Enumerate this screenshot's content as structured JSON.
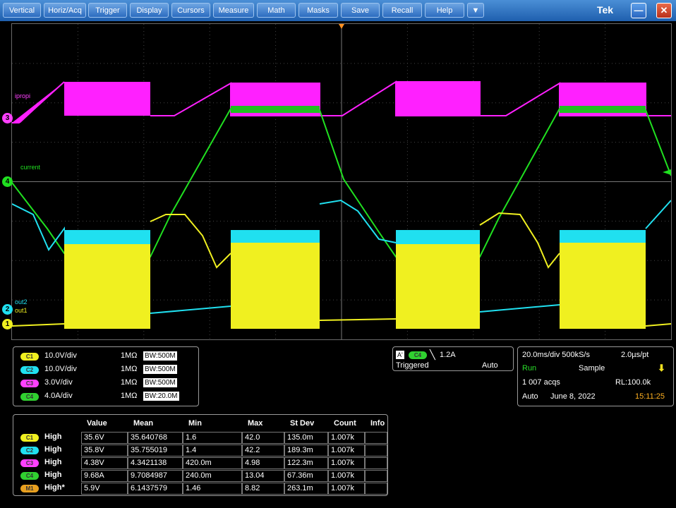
{
  "menubar": {
    "items": [
      "Vertical",
      "Horiz/Acq",
      "Trigger",
      "Display",
      "Cursors",
      "Measure",
      "Math",
      "Masks",
      "Save",
      "Recall",
      "Help"
    ],
    "dropdown_icon": "triangle-down-icon",
    "brand": "Tek",
    "minimize_icon": "minimize-icon",
    "close_icon": "close-icon"
  },
  "waveform": {
    "labels": {
      "ch3": "ipropi",
      "ch4": "current",
      "ch2": "out2",
      "ch1": "out1"
    },
    "markers": {
      "ch1": "1",
      "ch2": "2",
      "ch3": "3",
      "ch4": "4"
    },
    "colors": {
      "ch1": "#f0f020",
      "ch2": "#20e0f0",
      "ch3": "#ff20ff",
      "ch4": "#20e020"
    }
  },
  "channels": [
    {
      "tag": "C1",
      "scale": "10.0V/div",
      "impedance": "1MΩ",
      "bw": "BW:500M",
      "color": "#f0f020"
    },
    {
      "tag": "C2",
      "scale": "10.0V/div",
      "impedance": "1MΩ",
      "bw": "BW:500M",
      "color": "#20e0f0"
    },
    {
      "tag": "C3",
      "scale": "3.0V/div",
      "impedance": "1MΩ",
      "bw": "BW:500M",
      "color": "#ff40ff"
    },
    {
      "tag": "C4",
      "scale": "4.0A/div",
      "impedance": "1MΩ",
      "bw": "BW:20.0M",
      "color": "#30d030"
    }
  ],
  "trigger": {
    "source_tag": "C4",
    "prefix": "A'",
    "level": "1.2A",
    "state": "Triggered",
    "mode": "Auto"
  },
  "acquisition": {
    "timebase": "20.0ms/div 500kS/s",
    "resolution": "2.0µs/pt",
    "state": "Run",
    "mode": "Sample",
    "acqs": "1 007 acqs",
    "record_length": "RL:100.0k",
    "auto": "Auto",
    "date": "June 8, 2022",
    "time": "15:11:25"
  },
  "measurements": {
    "headers": [
      "Value",
      "Mean",
      "Min",
      "Max",
      "St Dev",
      "Count",
      "Info"
    ],
    "rows": [
      {
        "tag": "C1",
        "name": "High",
        "color": "#f0f020",
        "values": [
          "35.6V",
          "35.640768",
          "1.6",
          "42.0",
          "135.0m",
          "1.007k",
          ""
        ]
      },
      {
        "tag": "C2",
        "name": "High",
        "color": "#20e0f0",
        "values": [
          "35.8V",
          "35.755019",
          "1.4",
          "42.2",
          "189.3m",
          "1.007k",
          ""
        ]
      },
      {
        "tag": "C3",
        "name": "High",
        "color": "#ff40ff",
        "values": [
          "4.38V",
          "4.3421138",
          "420.0m",
          "4.98",
          "122.3m",
          "1.007k",
          ""
        ]
      },
      {
        "tag": "C4",
        "name": "High",
        "color": "#30d030",
        "values": [
          "9.68A",
          "9.7084987",
          "240.0m",
          "13.04",
          "67.36m",
          "1.007k",
          ""
        ]
      },
      {
        "tag": "M1",
        "name": "High*",
        "color": "#e8a020",
        "values": [
          "5.9V",
          "6.1437579",
          "1.46",
          "8.82",
          "263.1m",
          "1.007k",
          ""
        ]
      }
    ]
  }
}
